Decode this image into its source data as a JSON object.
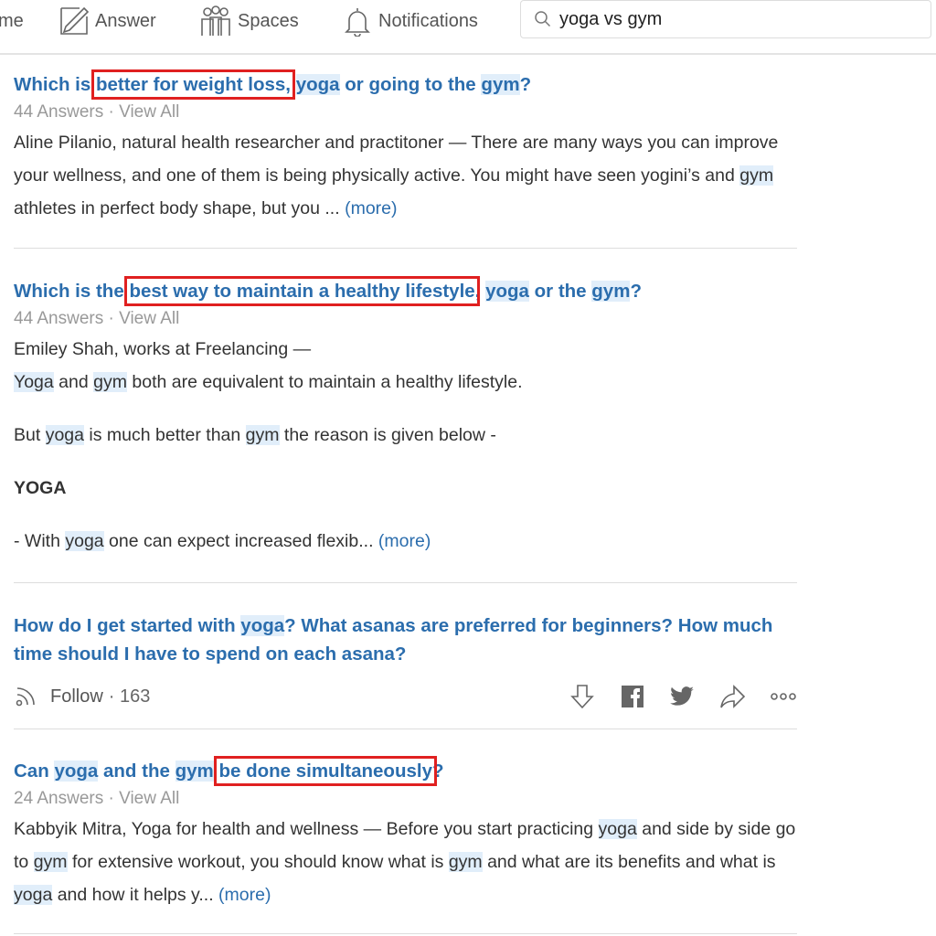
{
  "nav": {
    "home_partial": "me",
    "answer": "Answer",
    "spaces": "Spaces",
    "notifications": "Notifications",
    "search_value": "yoga vs gym"
  },
  "results": [
    {
      "title": [
        {
          "t": "Which is "
        },
        {
          "t": "better for weight loss,",
          "box": true
        },
        {
          "t": " "
        },
        {
          "t": "yoga",
          "hl": true
        },
        {
          "t": " or going to the "
        },
        {
          "t": "gym",
          "hl": true
        },
        {
          "t": "?"
        }
      ],
      "answers": "44 Answers",
      "view_all": "View All",
      "paras": [
        [
          {
            "t": "Aline Pilanio, natural health researcher and practitoner — There are many ways you can improve your wellness, and one of them is being physically active. You might have seen yogini’s and "
          },
          {
            "t": "gym",
            "hl": true
          },
          {
            "t": " athletes in perfect body shape, but you ... "
          },
          {
            "t": "(more)",
            "more": true
          }
        ]
      ]
    },
    {
      "title": [
        {
          "t": "Which is the "
        },
        {
          "t": "best way to maintain a healthy lifestyle",
          "box": true
        },
        {
          "t": ", "
        },
        {
          "t": "yoga",
          "hl": true
        },
        {
          "t": " or the "
        },
        {
          "t": "gym",
          "hl": true
        },
        {
          "t": "?"
        }
      ],
      "answers": "44 Answers",
      "view_all": "View All",
      "paras": [
        [
          {
            "t": "Emiley Shah, works at Freelancing —"
          }
        ],
        [
          {
            "t": "Yoga",
            "hl": true
          },
          {
            "t": " and "
          },
          {
            "t": "gym",
            "hl": true
          },
          {
            "t": " both are equivalent to maintain a healthy lifestyle."
          }
        ],
        [
          {
            "t": "But "
          },
          {
            "t": "yoga",
            "hl": true
          },
          {
            "t": " is much better than "
          },
          {
            "t": "gym",
            "hl": true
          },
          {
            "t": " the reason is given below -"
          }
        ],
        [
          {
            "t": "YOGA",
            "bold": true
          }
        ],
        [
          {
            "t": "- With "
          },
          {
            "t": "yoga",
            "hl": true
          },
          {
            "t": " one can expect increased flexib... "
          },
          {
            "t": "(more)",
            "more": true
          }
        ]
      ]
    },
    {
      "title": [
        {
          "t": "How do I get started with "
        },
        {
          "t": "yoga",
          "hl": true
        },
        {
          "t": "? What asanas are preferred for beginners? How much time should I have to spend on each asana?"
        }
      ],
      "follow": "Follow",
      "follow_count": "· 163"
    },
    {
      "title": [
        {
          "t": "Can "
        },
        {
          "t": "yoga",
          "hl": true
        },
        {
          "t": " and the "
        },
        {
          "t": "gym",
          "hl": true
        },
        {
          "t": " "
        },
        {
          "t": "be done simultaneously",
          "box": true
        },
        {
          "t": "?"
        }
      ],
      "answers": "24 Answers",
      "view_all": "View All",
      "paras": [
        [
          {
            "t": "Kabbyik Mitra, Yoga for health and wellness — Before you start practicing "
          },
          {
            "t": "yoga",
            "hl": true
          },
          {
            "t": " and side by side go to "
          },
          {
            "t": "gym",
            "hl": true
          },
          {
            "t": " for extensive workout, you should know what is "
          },
          {
            "t": "gym",
            "hl": true
          },
          {
            "t": " and what are its benefits and what is "
          },
          {
            "t": "yoga",
            "hl": true
          },
          {
            "t": " and how it helps y... "
          },
          {
            "t": "(more)",
            "more": true
          }
        ]
      ]
    }
  ],
  "colors": {
    "link": "#2b6dad",
    "highlight": "#e1eefa",
    "annotation_box": "#e02020"
  }
}
